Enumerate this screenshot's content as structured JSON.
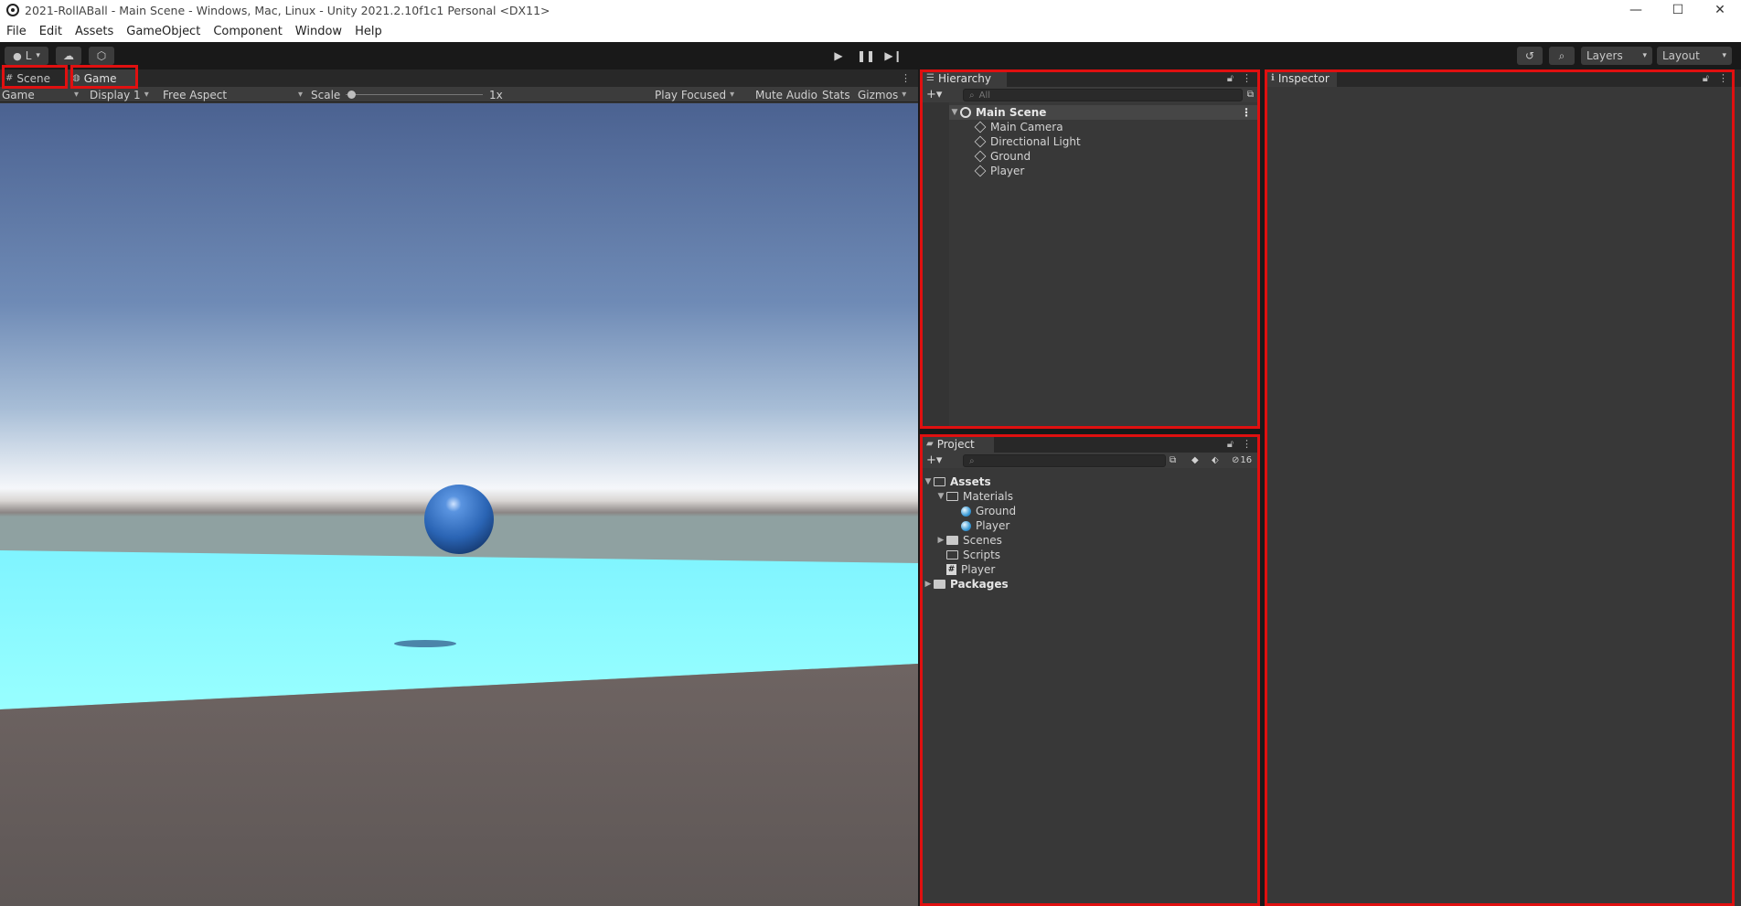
{
  "window": {
    "title": "2021-RollABall - Main Scene - Windows, Mac, Linux - Unity 2021.2.10f1c1 Personal <DX11>",
    "minimize": "—",
    "maximize": "☐",
    "close": "✕"
  },
  "menu": [
    "File",
    "Edit",
    "Assets",
    "GameObject",
    "Component",
    "Window",
    "Help"
  ],
  "toolbar": {
    "account_label": "L",
    "layers_label": "Layers",
    "layout_label": "Layout"
  },
  "tabs": {
    "scene": "Scene",
    "game": "Game"
  },
  "game_toolbar": {
    "mode": "Game",
    "display": "Display 1",
    "aspect": "Free Aspect",
    "scale_label": "Scale",
    "scale_value": "1x",
    "play_focused": "Play Focused",
    "mute_audio": "Mute Audio",
    "stats": "Stats",
    "gizmos": "Gizmos"
  },
  "hierarchy": {
    "title": "Hierarchy",
    "search_placeholder": "All",
    "scene_name": "Main Scene",
    "items": [
      "Main Camera",
      "Directional Light",
      "Ground",
      "Player"
    ]
  },
  "project": {
    "title": "Project",
    "hidden_count": "16",
    "tree": {
      "assets": "Assets",
      "materials": "Materials",
      "materials_items": [
        "Ground",
        "Player"
      ],
      "scenes": "Scenes",
      "scripts": "Scripts",
      "player_script": "Player",
      "packages": "Packages"
    }
  },
  "inspector": {
    "title": "Inspector"
  },
  "colors": {
    "editor_bg": "#383838",
    "highlight_outline": "#e01010",
    "player_sphere": "#2f6fc0",
    "ground": "#8affff"
  }
}
